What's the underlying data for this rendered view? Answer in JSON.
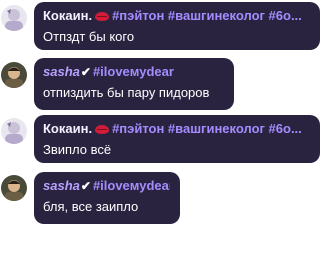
{
  "messages": [
    {
      "sender_name": "Кокаин.",
      "sender_rest": "#пэйтон #вашгинеколог #6о...",
      "text": "Отпздт бы кого",
      "avatar": "profile-avatar-1"
    },
    {
      "sender_name": "sasha",
      "sender_rest": "#iloveмуdear",
      "text": "отпиздить бы пару пидоров",
      "avatar": "profile-avatar-2"
    },
    {
      "sender_name": "Кокаин.",
      "sender_rest": "#пэйтон #вашгинеколог #6о...",
      "text": "Звипло всё",
      "avatar": "profile-avatar-1"
    },
    {
      "sender_name": "sasha",
      "sender_rest": "#iloveмуdear",
      "text": "бля, все заипло",
      "avatar": "profile-avatar-2"
    }
  ]
}
